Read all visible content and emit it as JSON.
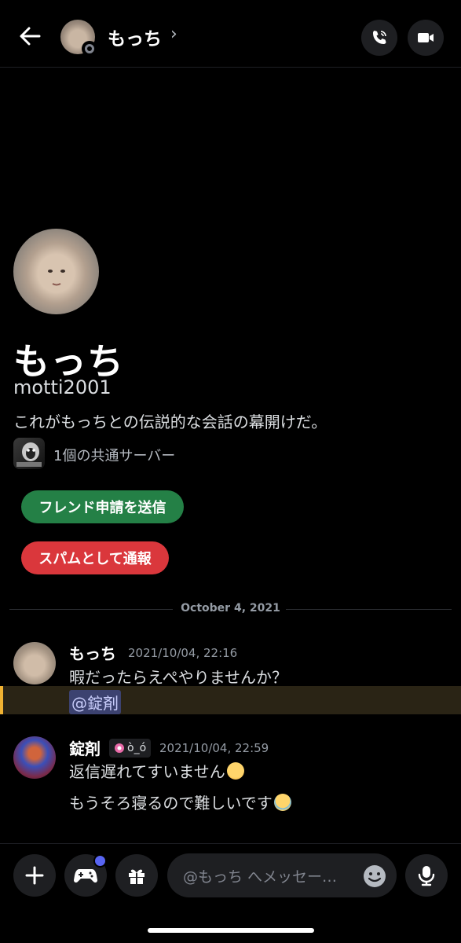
{
  "header": {
    "name": "もっち",
    "chevron": "›"
  },
  "profile": {
    "display_name": "もっち",
    "username": "motti2001",
    "bio": "これがもっちとの伝説的な会話の幕開けだ。",
    "mutual_servers": "1個の共通サーバー",
    "add_friend_label": "フレンド申請を送信",
    "report_spam_label": "スパムとして通報"
  },
  "divider_date": "October 4, 2021",
  "messages": [
    {
      "author": "もっち",
      "timestamp": "2021/10/04, 22:16",
      "lines": [
        "暇だったらえぺやりませんか？"
      ],
      "mention": "@錠剤"
    },
    {
      "author": "錠剤",
      "tag": "ò_ó",
      "timestamp": "2021/10/04, 22:59",
      "lines": [
        "返信遅れてすいません",
        "もうそろ寝るので難しいです"
      ]
    }
  ],
  "composer": {
    "placeholder": "@もっち へメッセー…"
  },
  "colors": {
    "accent": "#5865f2",
    "green": "#248046",
    "red": "#da373c",
    "mention_highlight": "#f0b232"
  },
  "icons": [
    "back-arrow-icon",
    "phone-icon",
    "video-icon",
    "plus-icon",
    "gamepad-icon",
    "gift-icon",
    "emoji-icon",
    "mic-icon"
  ]
}
